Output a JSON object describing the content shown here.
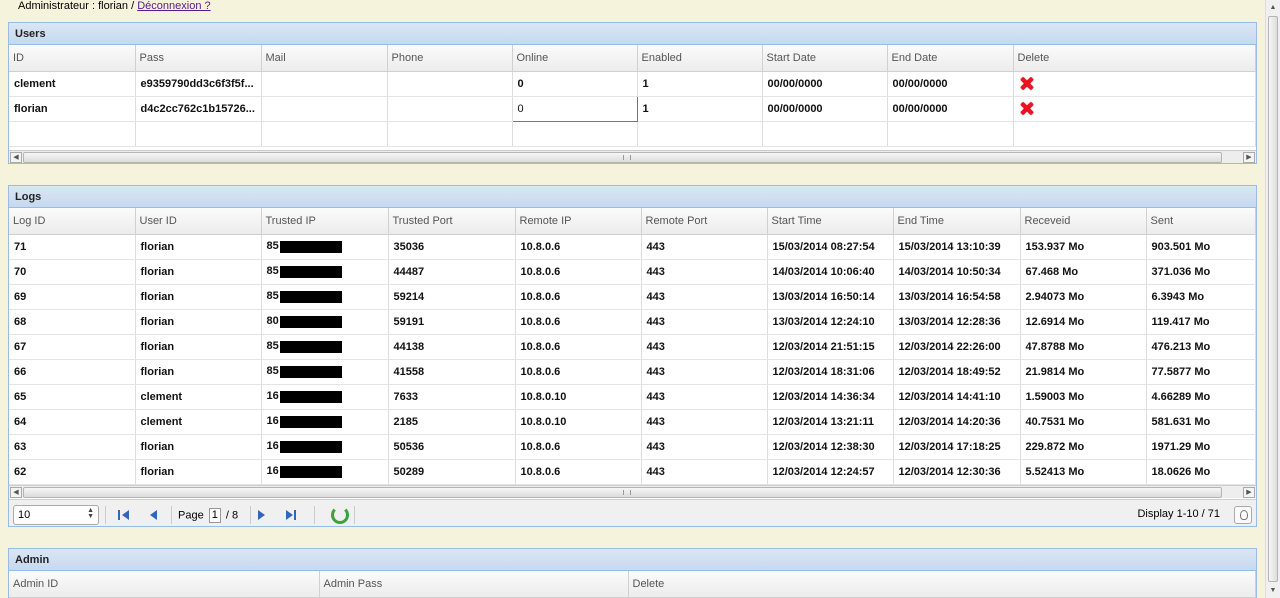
{
  "topbar": {
    "prefix": "Administrateur : florian /",
    "logout_link": "Déconnexion ?"
  },
  "users_panel": {
    "title": "Users",
    "columns": [
      "ID",
      "Pass",
      "Mail",
      "Phone",
      "Online",
      "Enabled",
      "Start Date",
      "End Date",
      "Delete"
    ],
    "rows": [
      {
        "id": "clement",
        "pass": "e9359790dd3c6f3f5f...",
        "mail": "",
        "phone": "",
        "online": "0",
        "enabled": "1",
        "start": "00/00/0000",
        "end": "00/00/0000"
      },
      {
        "id": "florian",
        "pass": "d4c2cc762c1b15726...",
        "mail": "",
        "phone": "",
        "online": "0",
        "enabled": "1",
        "start": "00/00/0000",
        "end": "00/00/0000"
      }
    ]
  },
  "logs_panel": {
    "title": "Logs",
    "columns": [
      "Log ID",
      "User ID",
      "Trusted IP",
      "Trusted Port",
      "Remote IP",
      "Remote Port",
      "Start Time",
      "End Time",
      "Receveid",
      "Sent"
    ],
    "rows": [
      {
        "log_id": "71",
        "user": "florian",
        "ip": "85",
        "port": "35036",
        "remote_ip": "10.8.0.6",
        "remote_port": "443",
        "start": "15/03/2014 08:27:54",
        "end": "15/03/2014 13:10:39",
        "recv": "153.937 Mo",
        "sent": "903.501 Mo"
      },
      {
        "log_id": "70",
        "user": "florian",
        "ip": "85",
        "port": "44487",
        "remote_ip": "10.8.0.6",
        "remote_port": "443",
        "start": "14/03/2014 10:06:40",
        "end": "14/03/2014 10:50:34",
        "recv": "67.468 Mo",
        "sent": "371.036 Mo"
      },
      {
        "log_id": "69",
        "user": "florian",
        "ip": "85",
        "port": "59214",
        "remote_ip": "10.8.0.6",
        "remote_port": "443",
        "start": "13/03/2014 16:50:14",
        "end": "13/03/2014 16:54:58",
        "recv": "2.94073 Mo",
        "sent": "6.3943 Mo"
      },
      {
        "log_id": "68",
        "user": "florian",
        "ip": "80",
        "port": "59191",
        "remote_ip": "10.8.0.6",
        "remote_port": "443",
        "start": "13/03/2014 12:24:10",
        "end": "13/03/2014 12:28:36",
        "recv": "12.6914 Mo",
        "sent": "119.417 Mo"
      },
      {
        "log_id": "67",
        "user": "florian",
        "ip": "85",
        "port": "44138",
        "remote_ip": "10.8.0.6",
        "remote_port": "443",
        "start": "12/03/2014 21:51:15",
        "end": "12/03/2014 22:26:00",
        "recv": "47.8788 Mo",
        "sent": "476.213 Mo"
      },
      {
        "log_id": "66",
        "user": "florian",
        "ip": "85",
        "port": "41558",
        "remote_ip": "10.8.0.6",
        "remote_port": "443",
        "start": "12/03/2014 18:31:06",
        "end": "12/03/2014 18:49:52",
        "recv": "21.9814 Mo",
        "sent": "77.5877 Mo"
      },
      {
        "log_id": "65",
        "user": "clement",
        "ip": "16",
        "port": "7633",
        "remote_ip": "10.8.0.10",
        "remote_port": "443",
        "start": "12/03/2014 14:36:34",
        "end": "12/03/2014 14:41:10",
        "recv": "1.59003 Mo",
        "sent": "4.66289 Mo"
      },
      {
        "log_id": "64",
        "user": "clement",
        "ip": "16",
        "port": "2185",
        "remote_ip": "10.8.0.10",
        "remote_port": "443",
        "start": "12/03/2014 13:21:11",
        "end": "12/03/2014 14:20:36",
        "recv": "40.7531 Mo",
        "sent": "581.631 Mo"
      },
      {
        "log_id": "63",
        "user": "florian",
        "ip": "16",
        "port": "50536",
        "remote_ip": "10.8.0.6",
        "remote_port": "443",
        "start": "12/03/2014 12:38:30",
        "end": "12/03/2014 17:18:25",
        "recv": "229.872 Mo",
        "sent": "1971.29 Mo"
      },
      {
        "log_id": "62",
        "user": "florian",
        "ip": "16",
        "port": "50289",
        "remote_ip": "10.8.0.6",
        "remote_port": "443",
        "start": "12/03/2014 12:24:57",
        "end": "12/03/2014 12:30:36",
        "recv": "5.52413 Mo",
        "sent": "18.0626 Mo"
      }
    ],
    "pager": {
      "page_size": "10",
      "page_label": "Page",
      "current_page": "1",
      "total_pages": "/  8",
      "display": "Display 1-10 / 71"
    }
  },
  "admin_panel": {
    "title": "Admin",
    "columns": [
      "Admin ID",
      "Admin Pass",
      "Delete"
    ]
  }
}
